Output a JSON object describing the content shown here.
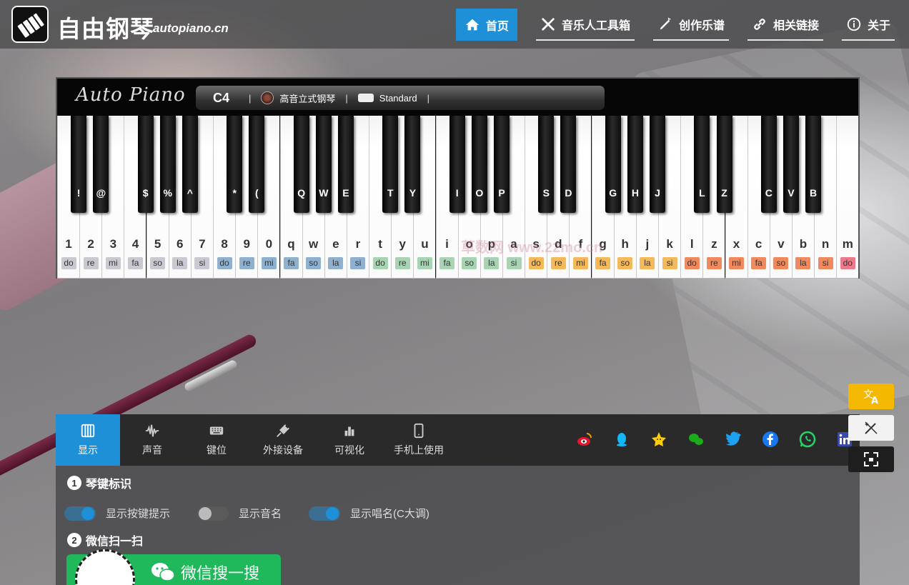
{
  "header": {
    "site_title": "自由钢琴",
    "site_domain": "autopiano.cn",
    "nav": [
      {
        "label": "首页",
        "icon": "home-icon",
        "active": true
      },
      {
        "label": "音乐人工具箱",
        "icon": "tools-icon",
        "active": false
      },
      {
        "label": "创作乐谱",
        "icon": "pen-icon",
        "active": false
      },
      {
        "label": "相关链接",
        "icon": "link-icon",
        "active": false
      },
      {
        "label": "关于",
        "icon": "info-icon",
        "active": false
      }
    ]
  },
  "piano": {
    "brand": "Auto Piano",
    "note": "C4",
    "separator": "|",
    "instrument": "高音立式钢琴",
    "mode": "Standard",
    "white_keys": [
      {
        "key": "1",
        "solfa": "do",
        "color": "#c9c9d1"
      },
      {
        "key": "2",
        "solfa": "re",
        "color": "#c9c9d1"
      },
      {
        "key": "3",
        "solfa": "mi",
        "color": "#c9c9d1"
      },
      {
        "key": "4",
        "solfa": "fa",
        "color": "#c9c9d1"
      },
      {
        "key": "5",
        "solfa": "so",
        "color": "#c9c9d1"
      },
      {
        "key": "6",
        "solfa": "la",
        "color": "#c9c9d1"
      },
      {
        "key": "7",
        "solfa": "si",
        "color": "#c9c9d1"
      },
      {
        "key": "8",
        "solfa": "do",
        "color": "#8fb0cf"
      },
      {
        "key": "9",
        "solfa": "re",
        "color": "#8fb0cf"
      },
      {
        "key": "0",
        "solfa": "mi",
        "color": "#8fb0cf"
      },
      {
        "key": "q",
        "solfa": "fa",
        "color": "#8fb0cf"
      },
      {
        "key": "w",
        "solfa": "so",
        "color": "#8fb0cf"
      },
      {
        "key": "e",
        "solfa": "la",
        "color": "#8fb0cf"
      },
      {
        "key": "r",
        "solfa": "si",
        "color": "#8fb0cf"
      },
      {
        "key": "t",
        "solfa": "do",
        "color": "#a8d4b4"
      },
      {
        "key": "y",
        "solfa": "re",
        "color": "#a8d4b4"
      },
      {
        "key": "u",
        "solfa": "mi",
        "color": "#a8d4b4"
      },
      {
        "key": "i",
        "solfa": "fa",
        "color": "#a8d4b4"
      },
      {
        "key": "o",
        "solfa": "so",
        "color": "#a8d4b4"
      },
      {
        "key": "p",
        "solfa": "la",
        "color": "#a8d4b4"
      },
      {
        "key": "a",
        "solfa": "si",
        "color": "#a8d4b4"
      },
      {
        "key": "s",
        "solfa": "do",
        "color": "#f3b95a"
      },
      {
        "key": "d",
        "solfa": "re",
        "color": "#f3b95a"
      },
      {
        "key": "f",
        "solfa": "mi",
        "color": "#f3b95a"
      },
      {
        "key": "g",
        "solfa": "fa",
        "color": "#f3b95a"
      },
      {
        "key": "h",
        "solfa": "so",
        "color": "#f3b95a"
      },
      {
        "key": "j",
        "solfa": "la",
        "color": "#f3b95a"
      },
      {
        "key": "k",
        "solfa": "si",
        "color": "#f3b95a"
      },
      {
        "key": "l",
        "solfa": "do",
        "color": "#ee8a5e"
      },
      {
        "key": "z",
        "solfa": "re",
        "color": "#ee8a5e"
      },
      {
        "key": "x",
        "solfa": "mi",
        "color": "#ee8a5e"
      },
      {
        "key": "c",
        "solfa": "fa",
        "color": "#ee8a5e"
      },
      {
        "key": "v",
        "solfa": "so",
        "color": "#ee8a5e"
      },
      {
        "key": "b",
        "solfa": "la",
        "color": "#ee8a5e"
      },
      {
        "key": "n",
        "solfa": "si",
        "color": "#ee8a5e"
      },
      {
        "key": "m",
        "solfa": "do",
        "color": "#ec7a8a"
      }
    ],
    "black_keys": [
      {
        "key": "!",
        "after": 0
      },
      {
        "key": "@",
        "after": 1
      },
      {
        "key": "$",
        "after": 3
      },
      {
        "key": "%",
        "after": 4
      },
      {
        "key": "^",
        "after": 5
      },
      {
        "key": "*",
        "after": 7
      },
      {
        "key": "(",
        "after": 8
      },
      {
        "key": "Q",
        "after": 10
      },
      {
        "key": "W",
        "after": 11
      },
      {
        "key": "E",
        "after": 12
      },
      {
        "key": "T",
        "after": 14
      },
      {
        "key": "Y",
        "after": 15
      },
      {
        "key": "I",
        "after": 17
      },
      {
        "key": "O",
        "after": 18
      },
      {
        "key": "P",
        "after": 19
      },
      {
        "key": "S",
        "after": 21
      },
      {
        "key": "D",
        "after": 22
      },
      {
        "key": "G",
        "after": 24
      },
      {
        "key": "H",
        "after": 25
      },
      {
        "key": "J",
        "after": 26
      },
      {
        "key": "L",
        "after": 28
      },
      {
        "key": "Z",
        "after": 29
      },
      {
        "key": "C",
        "after": 31
      },
      {
        "key": "V",
        "after": 32
      },
      {
        "key": "B",
        "after": 33
      }
    ]
  },
  "watermark": "草数网 www.22mo.cn",
  "panel": {
    "tabs": [
      {
        "label": "显示",
        "icon": "piano-keys-icon",
        "active": true
      },
      {
        "label": "声音",
        "icon": "waveform-icon",
        "active": false
      },
      {
        "label": "键位",
        "icon": "keyboard-icon",
        "active": false
      },
      {
        "label": "外接设备",
        "icon": "plug-icon",
        "active": false
      },
      {
        "label": "可视化",
        "icon": "bar-chart-icon",
        "active": false
      },
      {
        "label": "手机上使用",
        "icon": "mobile-icon",
        "active": false
      }
    ],
    "social": [
      "weibo-icon",
      "qq-icon",
      "qzone-icon",
      "wechat-icon",
      "twitter-icon",
      "facebook-icon",
      "whatsapp-icon",
      "linkedin-icon"
    ],
    "section1": {
      "num": "1",
      "title": "琴键标识"
    },
    "toggles": [
      {
        "label": "显示按键提示",
        "on": true
      },
      {
        "label": "显示音名",
        "on": false
      },
      {
        "label": "显示唱名(C大调)",
        "on": true
      }
    ],
    "section2": {
      "num": "2",
      "title": "微信扫一扫"
    },
    "wechat_button": "微信搜一搜"
  },
  "colors": {
    "accent": "#1e90d8",
    "translate_btn": "#f5b800",
    "wechat_green": "#1fb85a"
  }
}
